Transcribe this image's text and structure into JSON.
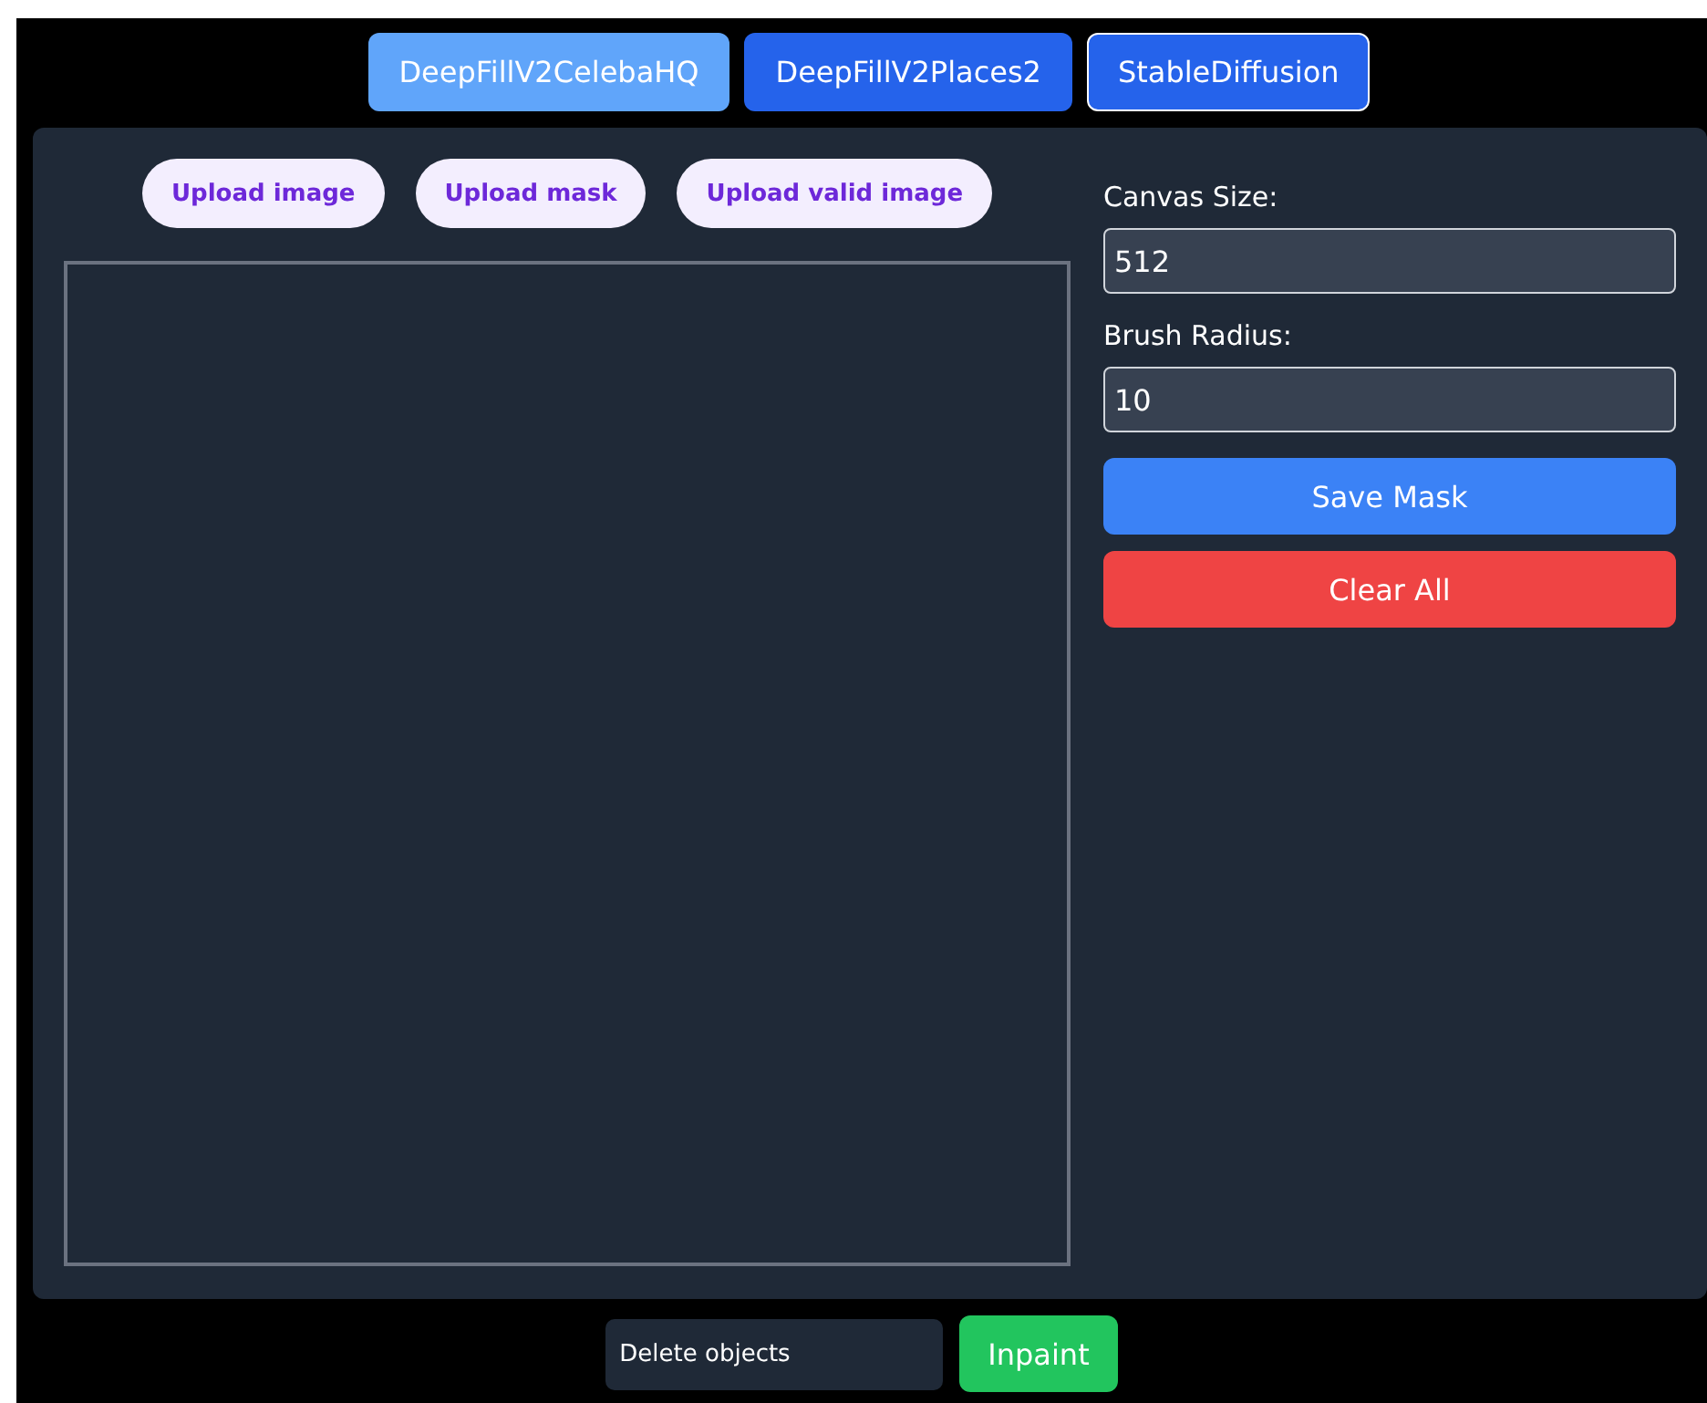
{
  "tabs": [
    {
      "label": "DeepFillV2CelebaHQ",
      "selected": false,
      "disabled": true
    },
    {
      "label": "DeepFillV2Places2",
      "selected": false,
      "disabled": false
    },
    {
      "label": "StableDiffusion",
      "selected": true,
      "disabled": false
    }
  ],
  "upload_buttons": [
    "Upload image",
    "Upload mask",
    "Upload valid image"
  ],
  "settings": [
    {
      "label": "Canvas Size:",
      "value": "512"
    },
    {
      "label": "Brush Radius:",
      "value": "10"
    }
  ],
  "actions": [
    {
      "label": "Save Mask",
      "kind": "primary"
    },
    {
      "label": "Clear All",
      "kind": "danger"
    }
  ],
  "prompt": {
    "value": "Delete objects"
  },
  "inpaint_button": "Inpaint"
}
